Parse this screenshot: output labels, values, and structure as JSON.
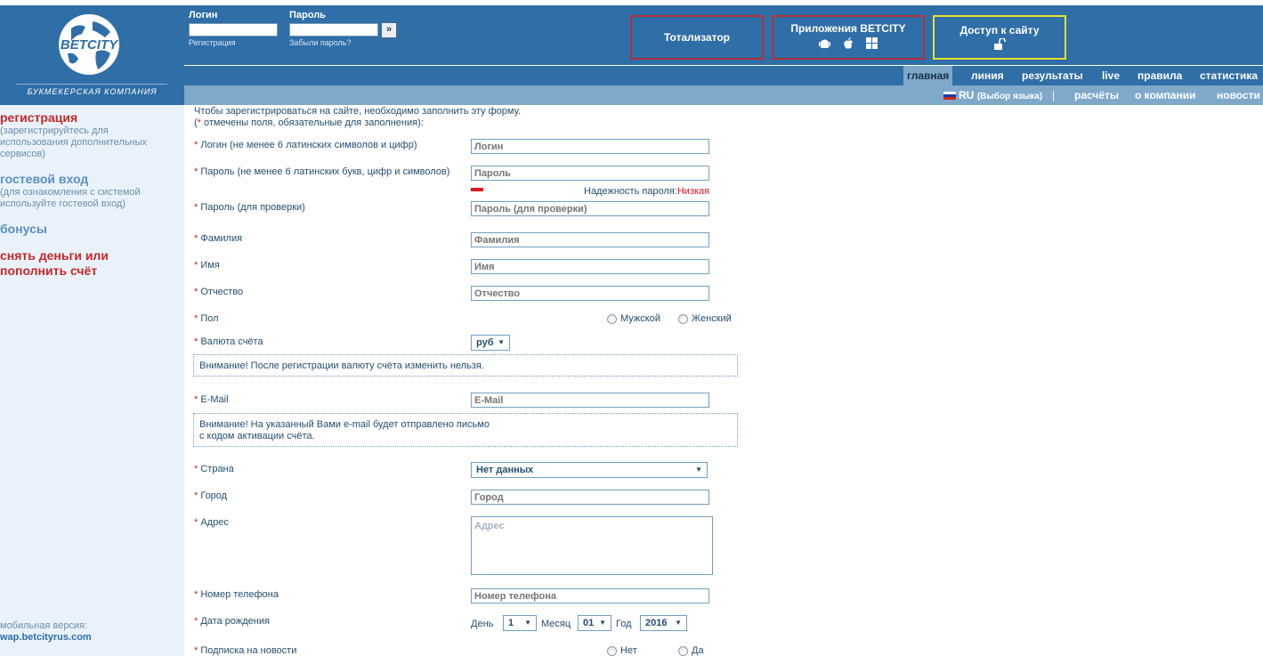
{
  "brand": {
    "logo_text": "BETCITY",
    "tagline": "БУКМЕКЕРСКАЯ КОМПАНИЯ"
  },
  "login": {
    "login_label": "Логин",
    "password_label": "Пароль",
    "register_link": "Регистрация",
    "forgot_link": "Забыли пароль?",
    "go_label": "»"
  },
  "header_buttons": {
    "tote": "Тотализатор",
    "apps": "Приложения BETCITY",
    "access": "Доступ к сайту"
  },
  "nav_main": [
    "главная",
    "линия",
    "результаты",
    "live",
    "правила",
    "статистика"
  ],
  "nav_secondary": {
    "lang_code": "RU",
    "lang_hint": "(Выбор языка)",
    "items": [
      "расчёты",
      "о компании",
      "новости"
    ]
  },
  "sidebar": {
    "register": "регистрация",
    "register_sub": "(зарегистрируйтесь для использования дополнительных сервисов)",
    "guest": "гостевой вход",
    "guest_sub": "(для ознакомления с системой используйте гостевой вход)",
    "bonuses": "бонусы",
    "money_line1": "снять деньги или",
    "money_line2": "пополнить счёт",
    "mobile_label": "мобильная версия:",
    "mobile_link": "wap.betcityrus.com"
  },
  "form": {
    "intro_line1": "Чтобы зарегистрироваться на сайте, необходимо заполнить эту форму.",
    "intro_line2_pre": "(",
    "intro_line2_post": " отмечены поля, обязательные для заполнения):",
    "star": "*",
    "login_label": "Логин (не менее 6 латинских символов и цифр)",
    "login_ph": "Логин",
    "password_label": "Пароль (не менее 6 латинских букв, цифр и символов)",
    "password_ph": "Пароль",
    "strength_label": "Надежность пароля:",
    "strength_value": "Низкая",
    "password2_label": "Пароль (для проверки)",
    "password2_ph": "Пароль (для проверки)",
    "surname_label": "Фамилия",
    "surname_ph": "Фамилия",
    "name_label": "Имя",
    "name_ph": "Имя",
    "patronymic_label": "Отчество",
    "patronymic_ph": "Отчество",
    "gender_label": "Пол",
    "gender_male": "Мужской",
    "gender_female": "Женский",
    "currency_label": "Валюта счёта",
    "currency_value": "руб",
    "currency_note": "Внимание! После регистрации валюту счёта изменить нельзя.",
    "email_label": "E-Mail",
    "email_ph": "E-Mail",
    "email_note_line1": "Внимание! На указанный Вами e-mail будет отправлено письмо",
    "email_note_line2": "с кодом активации счёта.",
    "country_label": "Страна",
    "country_value": "Нет данных",
    "city_label": "Город",
    "city_ph": "Город",
    "address_label": "Адрес",
    "address_ph": "Адрес",
    "phone_label": "Номер телефона",
    "phone_ph": "Номер телефона",
    "birth_label": "Дата рождения",
    "day_label": "День",
    "day_value": "1",
    "month_label": "Месяц",
    "month_value": "01",
    "year_label": "Год",
    "year_value": "2016",
    "newsletter_label": "Подписка на новости",
    "newsletter_no": "Нет",
    "newsletter_yes": "Да"
  },
  "colors": {
    "header_blue": "#2f6ea7",
    "nav_light": "#7fa9ca",
    "sidebar_bg": "#e9f2fa",
    "accent_red": "#c62828",
    "highlight_yellow": "#e6e12c"
  }
}
